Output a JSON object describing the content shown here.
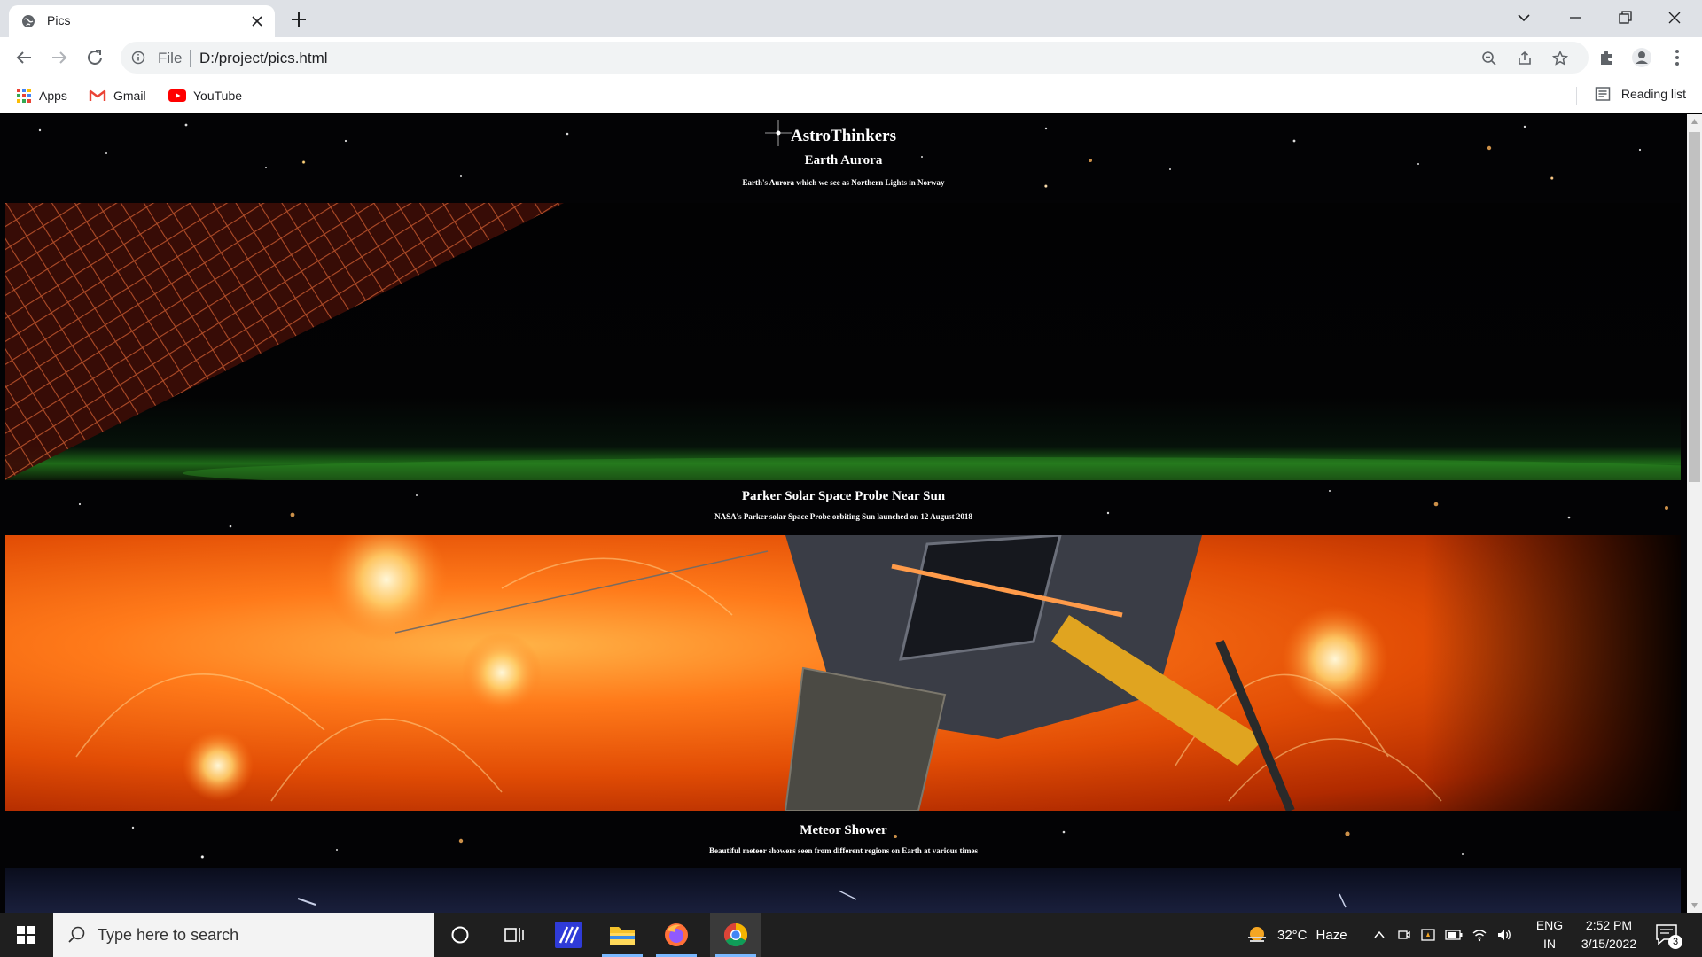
{
  "browser": {
    "tab": {
      "title": "Pics"
    },
    "address": {
      "scheme": "File",
      "url": "D:/project/pics.html"
    },
    "bookmarks": [
      {
        "label": "Apps"
      },
      {
        "label": "Gmail"
      },
      {
        "label": "YouTube"
      }
    ],
    "reading_list": "Reading list"
  },
  "page": {
    "title": "AstroThinkers",
    "sections": [
      {
        "heading": "Earth Aurora",
        "caption": "Earth's Aurora which we see as Northern Lights in Norway"
      },
      {
        "heading": "Parker Solar Space Probe Near Sun",
        "caption": "NASA's Parker solar Space Probe orbiting Sun launched on 12 August 2018"
      },
      {
        "heading": "Meteor Shower",
        "caption": "Beautiful meteor showers seen from different regions on Earth at various times"
      }
    ]
  },
  "taskbar": {
    "search_placeholder": "Type here to search",
    "weather": {
      "temp": "32°C",
      "condition": "Haze"
    },
    "language": {
      "lang": "ENG",
      "region": "IN"
    },
    "clock": {
      "time": "2:52 PM",
      "date": "3/15/2022"
    },
    "notification_count": "3"
  }
}
